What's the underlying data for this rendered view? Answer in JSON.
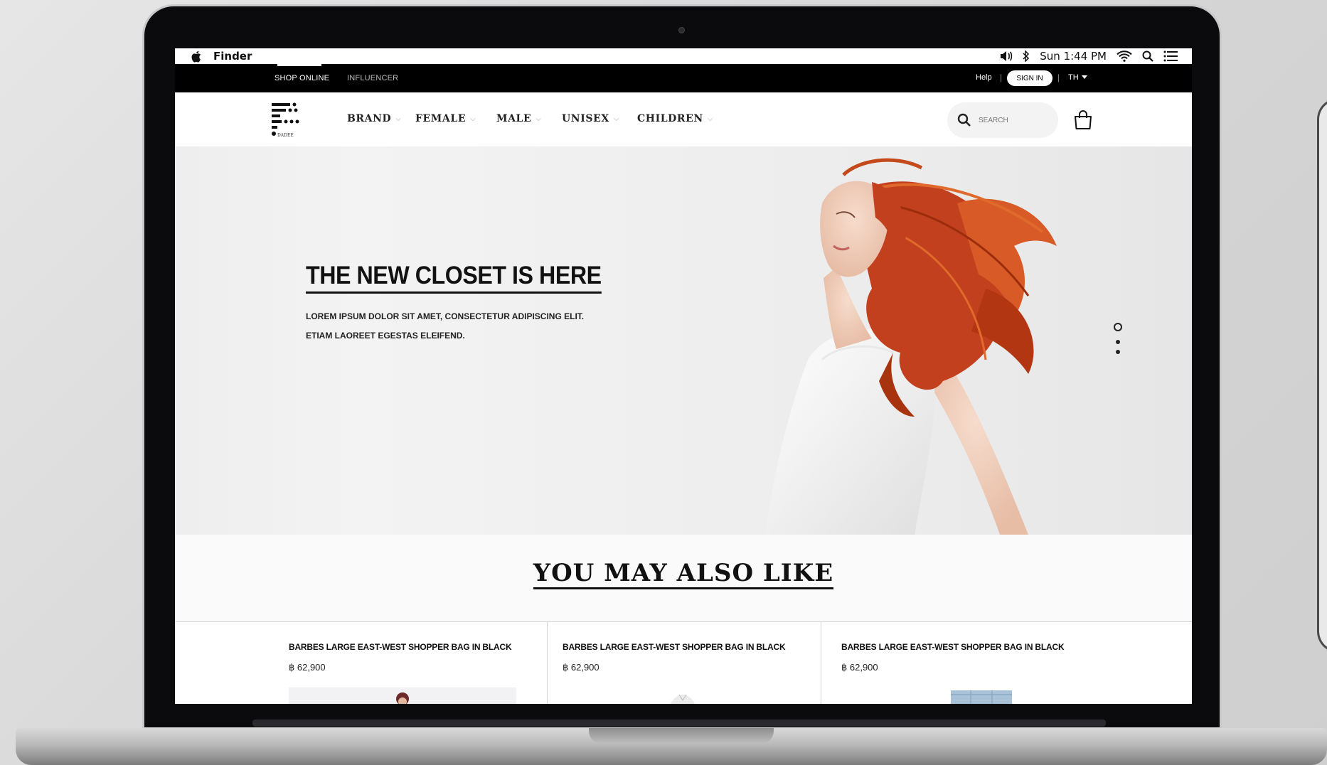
{
  "menubar": {
    "app_name": "Finder",
    "clock": "Sun 1:44 PM"
  },
  "topstrip": {
    "tabs": [
      "SHOP ONLINE",
      "INFLUENCER"
    ],
    "help": "Help",
    "signin": "SIGN IN",
    "language": "TH"
  },
  "nav": {
    "items": [
      "BRAND",
      "FEMALE",
      "MALE",
      "UNISEX",
      "CHILDREN"
    ],
    "search_placeholder": "SEARCH"
  },
  "hero": {
    "title": "THE NEW CLOSET IS HERE",
    "subtitle_line1": "LOREM IPSUM DOLOR SIT AMET, CONSECTETUR ADIPISCING ELIT.",
    "subtitle_line2": "ETIAM LAOREET EGESTAS ELEIFEND.",
    "slide_count": 3,
    "active_slide": 1
  },
  "recommendations": {
    "title": "YOU MAY ALSO LIKE",
    "products": [
      {
        "name": "BARBES LARGE EAST-WEST SHOPPER BAG IN BLACK",
        "price": "฿ 62,900"
      },
      {
        "name": "BARBES LARGE EAST-WEST SHOPPER BAG IN BLACK",
        "price": "฿ 62,900"
      },
      {
        "name": "BARBES LARGE EAST-WEST SHOPPER BAG IN BLACK",
        "price": "฿ 62,900"
      }
    ]
  },
  "colors": {
    "accent": "#000000",
    "hero_bg": "#efefef",
    "hair": "#c2401e"
  }
}
